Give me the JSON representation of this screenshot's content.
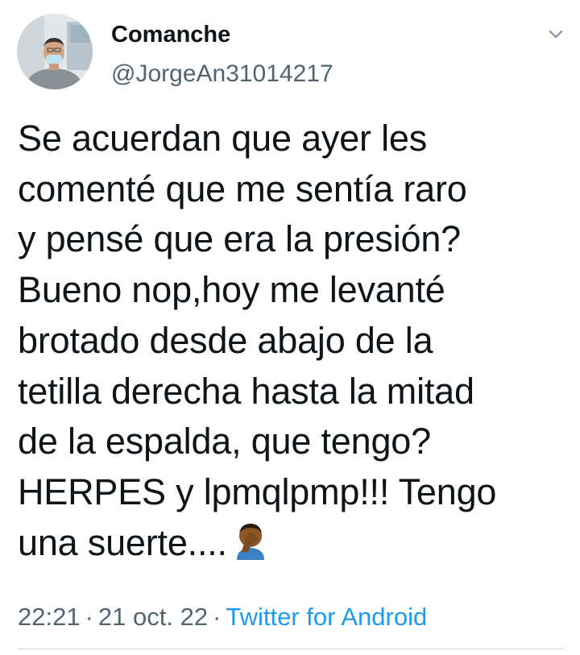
{
  "tweet": {
    "author": {
      "display_name": "Comanche",
      "handle": "@JorgeAn31014217",
      "avatar_icon": "profile-photo"
    },
    "more_icon": "chevron-down-icon",
    "text": "Se acuerdan que ayer les\ncomenté que me sentía raro\ny pensé que era la presión?\nBueno nop,hoy me levanté\nbrotado desde abajo de la\ntetilla derecha hasta la mitad\nde la espalda, que tengo?\nHERPES y lpmqlpmp!!! Tengo\nuna suerte....",
    "emoji_icon": "face-palm-emoji",
    "time": "22:21",
    "date": "21 oct. 22",
    "source": "Twitter for Android",
    "separator": "·"
  },
  "colors": {
    "text": "#0f1419",
    "secondary": "#536471",
    "link": "#1d9bf0",
    "divider": "#cfd9de"
  }
}
